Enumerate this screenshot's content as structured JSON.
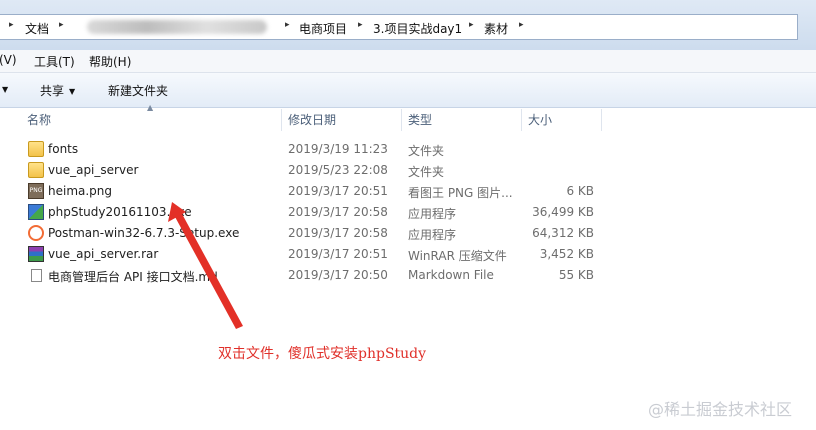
{
  "address_bar": {
    "crumbs": [
      "文档",
      "电商项目",
      "3.项目实战day1",
      "素材"
    ],
    "separator": "▸"
  },
  "menu_bar": {
    "items": [
      "(V)",
      "工具(T)",
      "帮助(H)"
    ]
  },
  "toolbar": {
    "share": "共享",
    "new_folder": "新建文件夹"
  },
  "columns": {
    "name": "名称",
    "modified": "修改日期",
    "type": "类型",
    "size": "大小"
  },
  "files": [
    {
      "name": "fonts",
      "modified": "2019/3/19 11:23",
      "type": "文件夹",
      "size": "",
      "icon": "folder-icon"
    },
    {
      "name": "vue_api_server",
      "modified": "2019/5/23 22:08",
      "type": "文件夹",
      "size": "",
      "icon": "folder-icon"
    },
    {
      "name": "heima.png",
      "modified": "2019/3/17 20:51",
      "type": "看图王 PNG 图片...",
      "size": "6 KB",
      "icon": "png-image-icon"
    },
    {
      "name": "phpStudy20161103.exe",
      "modified": "2019/3/17 20:58",
      "type": "应用程序",
      "size": "36,499 KB",
      "icon": "phpstudy-app-icon"
    },
    {
      "name": "Postman-win32-6.7.3-Setup.exe",
      "modified": "2019/3/17 20:58",
      "type": "应用程序",
      "size": "64,312 KB",
      "icon": "postman-app-icon"
    },
    {
      "name": "vue_api_server.rar",
      "modified": "2019/3/17 20:51",
      "type": "WinRAR 压缩文件",
      "size": "3,452 KB",
      "icon": "winrar-archive-icon"
    },
    {
      "name": "电商管理后台 API 接口文档.md",
      "modified": "2019/3/17 20:50",
      "type": "Markdown File",
      "size": "55 KB",
      "icon": "markdown-file-icon"
    }
  ],
  "annotation": {
    "text": "双击文件，傻瓜式安装phpStudy",
    "color": "#e0302a"
  },
  "watermark": "@稀土掘金技术社区"
}
